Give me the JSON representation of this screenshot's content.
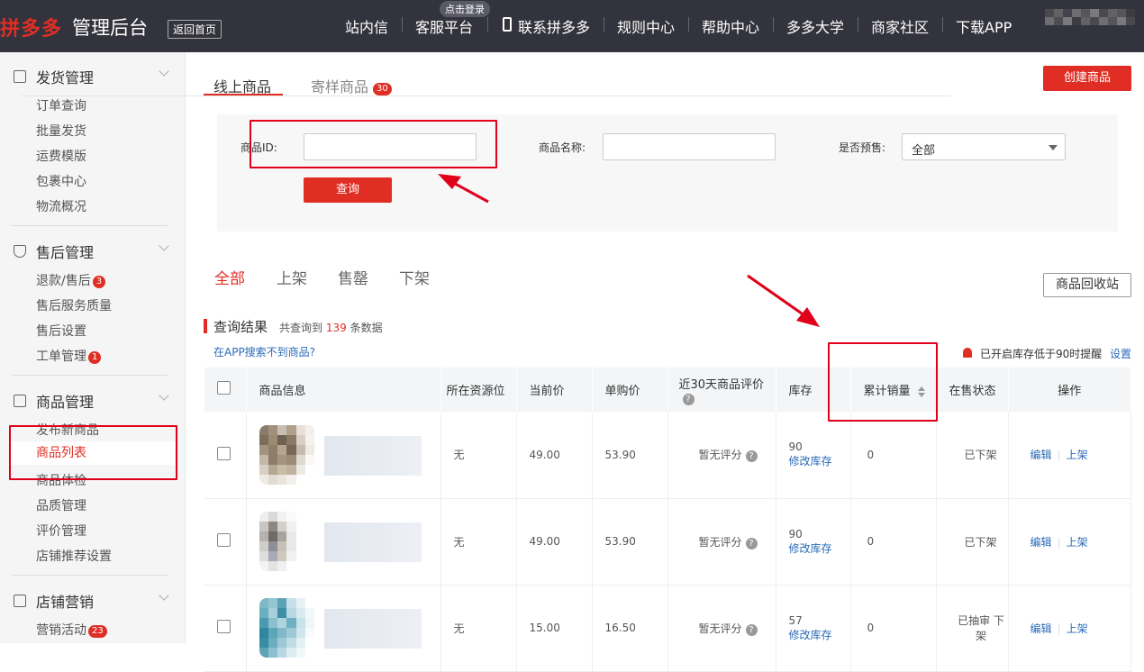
{
  "header": {
    "brand": "拼多多",
    "suffix": "管理后台",
    "back": "返回首页",
    "login_hint": "点击登录",
    "nav": [
      "站内信",
      "客服平台",
      "联系拼多多",
      "规则中心",
      "帮助中心",
      "多多大学",
      "商家社区",
      "下载APP"
    ]
  },
  "sidebar": {
    "sections": [
      {
        "title": "发货管理",
        "items": [
          {
            "label": "订单查询"
          },
          {
            "label": "批量发货"
          },
          {
            "label": "运费模版"
          },
          {
            "label": "包裹中心"
          },
          {
            "label": "物流概况"
          }
        ]
      },
      {
        "title": "售后管理",
        "items": [
          {
            "label": "退款/售后",
            "badge": "3"
          },
          {
            "label": "售后服务质量"
          },
          {
            "label": "售后设置"
          },
          {
            "label": "工单管理",
            "badge": "1"
          }
        ]
      },
      {
        "title": "商品管理",
        "items": [
          {
            "label": "发布新商品"
          },
          {
            "label": "商品列表",
            "active": true
          },
          {
            "label": "商品体检"
          },
          {
            "label": "品质管理"
          },
          {
            "label": "评价管理"
          },
          {
            "label": "店铺推荐设置"
          }
        ]
      },
      {
        "title": "店铺营销",
        "items": [
          {
            "label": "营销活动",
            "badge": "23"
          }
        ]
      }
    ]
  },
  "tabs": {
    "online": "线上商品",
    "sample": "寄样商品",
    "sample_badge": "30"
  },
  "create_button": "创建商品",
  "filters": {
    "id_label": "商品ID:",
    "name_label": "商品名称:",
    "presale_label": "是否预售:",
    "presale_value": "全部",
    "query": "查询"
  },
  "status_tabs": [
    "全部",
    "上架",
    "售罄",
    "下架"
  ],
  "recycle": "商品回收站",
  "results": {
    "title": "查询结果",
    "prefix": "共查询到",
    "count": "139",
    "suffix": "条数据",
    "app_link": "在APP搜索不到商品?",
    "reminder": "已开启库存低于90时提醒",
    "settings": "设置"
  },
  "table": {
    "headers": [
      "商品信息",
      "所在资源位",
      "当前价",
      "单购价",
      "近30天商品评价",
      "库存",
      "累计销量",
      "在售状态",
      "操作"
    ],
    "rows": [
      {
        "slot": "无",
        "price": "49.00",
        "single": "53.90",
        "review": "暂无评分",
        "stock": "90",
        "edit_stock": "修改库存",
        "sales": "0",
        "status": "已下架",
        "edit": "编辑",
        "list": "上架"
      },
      {
        "slot": "无",
        "price": "49.00",
        "single": "53.90",
        "review": "暂无评分",
        "stock": "90",
        "edit_stock": "修改库存",
        "sales": "0",
        "status": "已下架",
        "edit": "编辑",
        "list": "上架"
      },
      {
        "slot": "无",
        "price": "15.00",
        "single": "16.50",
        "review": "暂无评分",
        "stock": "57",
        "edit_stock": "修改库存",
        "sales": "0",
        "status": "已抽审 下架",
        "edit": "编辑",
        "list": "上架"
      }
    ]
  },
  "colors": {
    "accent": "#e02e24",
    "topbar": "#33333d",
    "link": "#2a6ab8"
  }
}
